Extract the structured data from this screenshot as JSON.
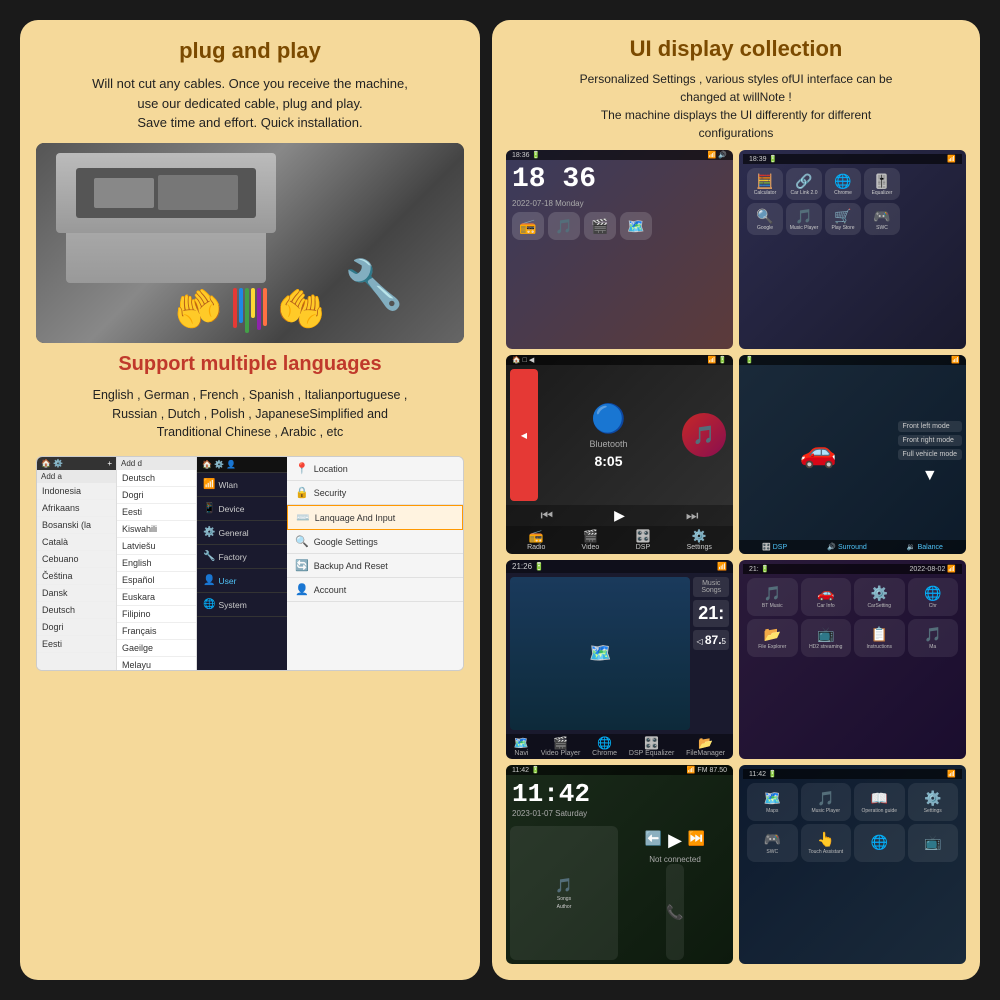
{
  "left": {
    "plug_title": "plug and play",
    "plug_desc": "Will not cut any cables. Once you receive the machine,\nuse our dedicated cable, plug and play.\nSave time and effort. Quick installation.",
    "lang_title": "Support multiple languages",
    "lang_desc": "English , German , French , Spanish , Italianportuguese ,\nRussian , Dutch , Polish , JapaneseSimplified and\nTranditional Chinese , Arabic , etc",
    "lang_list_col1": [
      "Indonesia",
      "Afrikaans",
      "Bosanski (la",
      "Català",
      "Cebuano",
      "Čeština",
      "Dansk",
      "Deutsch",
      "Dogri",
      "Eesti"
    ],
    "lang_list_col2": [
      "Deutsch",
      "Dogri",
      "Eesti",
      "Kiswahili",
      "Latviešu",
      "English",
      "Español",
      "Euskara",
      "Filipino",
      "Français",
      "Gaeilge"
    ],
    "settings_menu": [
      {
        "icon": "📶",
        "label": "Wlan",
        "active": false
      },
      {
        "icon": "📱",
        "label": "Device",
        "active": false
      },
      {
        "icon": "⚙️",
        "label": "General",
        "active": false
      },
      {
        "icon": "🔧",
        "label": "Factory",
        "active": false
      },
      {
        "icon": "👤",
        "label": "User",
        "active": true
      },
      {
        "icon": "🌐",
        "label": "System",
        "active": false
      }
    ],
    "settings_right": [
      {
        "icon": "📍",
        "label": "Location",
        "highlighted": false
      },
      {
        "icon": "🔒",
        "label": "Security",
        "highlighted": false
      },
      {
        "icon": "⌨️",
        "label": "Lanquage And Input",
        "highlighted": true
      },
      {
        "icon": "🔍",
        "label": "Google Settings",
        "highlighted": false
      },
      {
        "icon": "🔄",
        "label": "Backup And Reset",
        "highlighted": false
      },
      {
        "icon": "👤",
        "label": "Account",
        "highlighted": false
      }
    ]
  },
  "right": {
    "title": "UI display collection",
    "desc": "Personalized Settings , various styles ofUI interface can be\nchanged at willNote !\nThe machine displays the UI differently for different\nconfigurations",
    "ui_cells": [
      {
        "id": "clock_music",
        "time": "18 36",
        "date": "2022-07-18  Monday",
        "icons": [
          "📻",
          "🎵",
          "🎬",
          "🗺️"
        ]
      },
      {
        "id": "app_grid",
        "status": "18:39",
        "apps": [
          {
            "emoji": "🧮",
            "label": "Calculator"
          },
          {
            "emoji": "🔗",
            "label": "Car Link 2.0"
          },
          {
            "emoji": "🌐",
            "label": "Chrome"
          },
          {
            "emoji": "🎚️",
            "label": "Equalizer"
          },
          {
            "emoji": "🔍",
            "label": "Google"
          },
          {
            "emoji": "🎵",
            "label": "Music Player"
          },
          {
            "emoji": "🛒",
            "label": "Play Store"
          },
          {
            "emoji": "🎮",
            "label": "SWC"
          }
        ]
      },
      {
        "id": "bluetooth",
        "time": "8:05",
        "bottom_items": [
          "📻 Radio",
          "🎬 Video",
          "🎛️ DSP",
          "⚙️ Settings"
        ]
      },
      {
        "id": "car_dsp",
        "modes": [
          "Front left mode",
          "Front right mode",
          "Full vehicle mode"
        ],
        "dsp_items": [
          "DSP",
          "🔊 Surround",
          "🔉 Balance"
        ]
      },
      {
        "id": "navigation",
        "time": "21:26",
        "speed": "87.5",
        "bottom_items": [
          "Navi",
          "Video Player",
          "Chrome",
          "DSP Equalizer",
          "FileManager"
        ]
      },
      {
        "id": "app_grid_2",
        "time": "21:",
        "apps": [
          {
            "emoji": "🎵",
            "label": "BT Music"
          },
          {
            "emoji": "🚗",
            "label": "Car Info"
          },
          {
            "emoji": "⚙️",
            "label": "CarSetting"
          },
          {
            "emoji": "🌐",
            "label": "Chr"
          },
          {
            "emoji": "📂",
            "label": "File Explorer"
          },
          {
            "emoji": "📺",
            "label": "HD2 streaming"
          },
          {
            "emoji": "📋",
            "label": "Instructions"
          },
          {
            "emoji": "🎵",
            "label": "Ma"
          }
        ]
      },
      {
        "id": "clock2",
        "time": "11:42",
        "date": "2023-01-07 Saturday",
        "apps": [
          "Songs/Author",
          "📞",
          "🎵",
          "⬅️",
          "▶️",
          "⏭️"
        ]
      },
      {
        "id": "app_grid_3",
        "time": "11:42",
        "apps": [
          {
            "emoji": "🗺️",
            "label": "Maps"
          },
          {
            "emoji": "🎵",
            "label": "Music Player"
          },
          {
            "emoji": "📖",
            "label": "Operation guide"
          },
          {
            "emoji": "⚙️",
            "label": "Settings"
          },
          {
            "emoji": "🎮",
            "label": "SWC"
          },
          {
            "emoji": "🚗",
            "label": "Touch Assistant"
          },
          {
            "emoji": "🌐",
            "label": ""
          },
          {
            "emoji": "📺",
            "label": ""
          }
        ]
      }
    ]
  }
}
